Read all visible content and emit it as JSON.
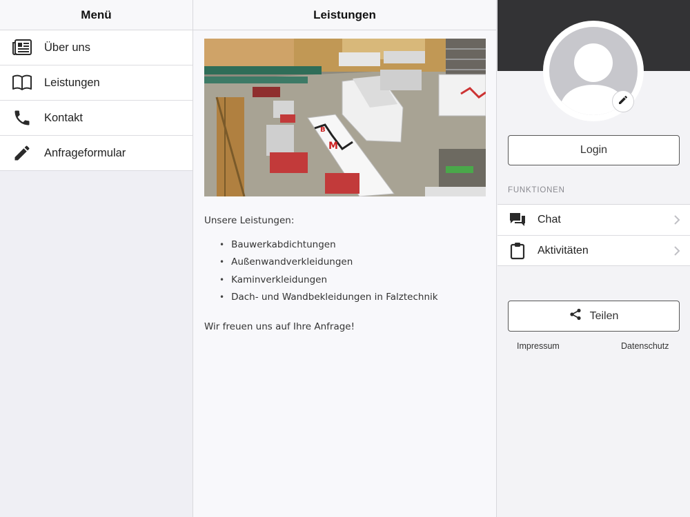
{
  "left": {
    "title": "Menü",
    "items": [
      {
        "label": "Über uns",
        "icon": "newspaper-icon"
      },
      {
        "label": "Leistungen",
        "icon": "book-icon"
      },
      {
        "label": "Kontakt",
        "icon": "phone-icon"
      },
      {
        "label": "Anfrageformular",
        "icon": "pencil-icon"
      }
    ]
  },
  "main": {
    "title": "Leistungen",
    "photo_icon": "workshop-photo",
    "intro": "Unsere Leistungen:",
    "services": [
      "Bauwerkabdichtungen",
      "Außenwandverkleidungen",
      "Kaminverkleidungen",
      "Dach- und Wandbekleidungen in Falztechnik"
    ],
    "closing": "Wir freuen uns auf Ihre Anfrage!"
  },
  "right": {
    "avatar_icon": "user-avatar-icon",
    "edit_icon": "pencil-icon",
    "login_label": "Login",
    "section_label": "FUNKTIONEN",
    "functions": [
      {
        "label": "Chat",
        "icon": "chat-icon"
      },
      {
        "label": "Aktivitäten",
        "icon": "clipboard-icon"
      }
    ],
    "share_label": "Teilen",
    "impressum": "Impressum",
    "datenschutz": "Datenschutz"
  },
  "colors": {
    "header_dark": "#333335",
    "avatar_gray": "#c7c7cc",
    "background": "#f3f3f6"
  }
}
